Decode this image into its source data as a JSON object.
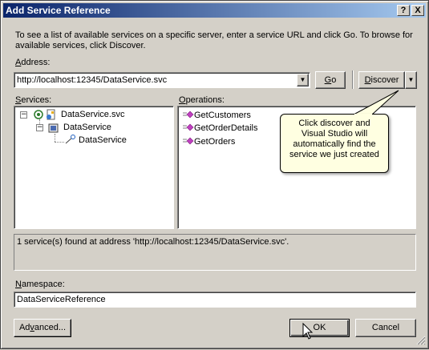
{
  "window": {
    "title": "Add Service Reference",
    "help_label": "?",
    "close_label": "X"
  },
  "description": "To see a list of available services on a specific server, enter a service URL and click Go. To browse for available services, click Discover.",
  "address": {
    "label_prefix": "",
    "label_access": "A",
    "label_rest": "ddress:",
    "value": "http://localhost:12345/DataService.svc",
    "dropdown_glyph": "▼"
  },
  "buttons": {
    "go_access": "G",
    "go_rest": "o",
    "discover_access": "D",
    "discover_rest": "iscover",
    "discover_arrow": "▼",
    "advanced_pre": "Ad",
    "advanced_access": "v",
    "advanced_rest": "anced...",
    "ok": "OK",
    "cancel": "Cancel"
  },
  "services": {
    "label_access": "S",
    "label_rest": "ervices:",
    "tree": [
      {
        "label": "DataService.svc",
        "expander": "−"
      },
      {
        "label": "DataService",
        "expander": "−"
      },
      {
        "label": "DataService"
      }
    ]
  },
  "operations": {
    "label_access": "O",
    "label_rest": "perations:",
    "items": [
      "GetCustomers",
      "GetOrderDetails",
      "GetOrders"
    ]
  },
  "callout": {
    "text_lines": [
      "Click discover and",
      "Visual Studio will",
      "automatically find the",
      "service we just created"
    ]
  },
  "status": "1 service(s) found at address 'http://localhost:12345/DataService.svc'.",
  "namespace": {
    "label_access": "N",
    "label_rest": "amespace:",
    "value": "DataServiceReference"
  },
  "colors": {
    "title_start": "#0a246a",
    "title_end": "#a6caf0",
    "dialog_bg": "#d4d0c8",
    "callout_bg": "#ffffe1",
    "operation_icon": "#c040c0"
  }
}
